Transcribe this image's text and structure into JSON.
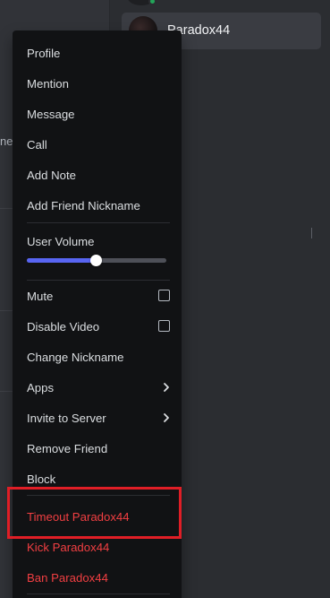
{
  "member_list": {
    "selected_member": {
      "name": "Paradox44"
    }
  },
  "background": {
    "fragment_text": "ne"
  },
  "context_menu": {
    "items_group1": [
      {
        "id": "profile",
        "label": "Profile"
      },
      {
        "id": "mention",
        "label": "Mention"
      },
      {
        "id": "message",
        "label": "Message"
      },
      {
        "id": "call",
        "label": "Call"
      },
      {
        "id": "add-note",
        "label": "Add Note"
      },
      {
        "id": "add-friend-nickname",
        "label": "Add Friend Nickname"
      }
    ],
    "user_volume": {
      "label": "User Volume",
      "value": 0.5
    },
    "items_group2": [
      {
        "id": "mute",
        "label": "Mute",
        "control": "checkbox",
        "checked": false
      },
      {
        "id": "disable-video",
        "label": "Disable Video",
        "control": "checkbox",
        "checked": false
      },
      {
        "id": "change-nickname",
        "label": "Change Nickname"
      },
      {
        "id": "apps",
        "label": "Apps",
        "control": "chevron-right-icon"
      },
      {
        "id": "invite-to-server",
        "label": "Invite to Server",
        "control": "chevron-right-icon"
      },
      {
        "id": "remove-friend",
        "label": "Remove Friend"
      },
      {
        "id": "block",
        "label": "Block"
      }
    ],
    "items_danger": [
      {
        "id": "timeout",
        "label": "Timeout Paradox44"
      },
      {
        "id": "kick",
        "label": "Kick Paradox44"
      },
      {
        "id": "ban",
        "label": "Ban Paradox44"
      }
    ]
  },
  "colors": {
    "menu_bg": "#111214",
    "text": "#dbdee1",
    "danger": "#f23f42",
    "accent": "#5865f2",
    "online": "#23a559",
    "highlight_outline": "#e01e26"
  }
}
